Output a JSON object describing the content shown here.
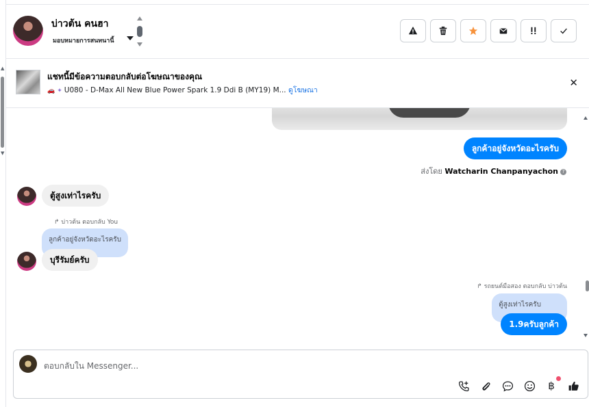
{
  "header": {
    "contact_name": "บ่าวต้น คนฮา",
    "assign_label": "มอบหมายการสนทนานี้",
    "actions": [
      {
        "name": "report-spam-button",
        "icon": "warning-icon"
      },
      {
        "name": "delete-button",
        "icon": "trash-icon"
      },
      {
        "name": "star-button",
        "icon": "star-icon",
        "color": "#f7923b"
      },
      {
        "name": "mark-unread-button",
        "icon": "envelope-icon"
      },
      {
        "name": "follow-up-button",
        "icon": "flag-exclaim-icon"
      },
      {
        "name": "mark-done-button",
        "icon": "check-icon"
      }
    ]
  },
  "ad": {
    "title": "แชทนี้มีข้อความตอบกลับต่อโฆษณาของคุณ",
    "product": "U080 - D-Max All New Blue Power Spark 1.9 Ddi B (MY19) M...",
    "link": "ดูโฆษณา"
  },
  "thread": {
    "msg1": "ลูกค้าอยู่จังหวัดอะไรครับ",
    "sent_by_prefix": "ส่งโดย",
    "sent_by_name": "Watcharin Chanpanyachon",
    "msg2": "ตู้สูงเท่าไรครับ",
    "reply1_meta": "บ่าวต้น ตอบกลับ You",
    "reply1_quote": "ลูกค้าอยู่จังหวัดอะไรครับ",
    "msg3": "บุรีรัมย์ครับ",
    "reply2_meta": "รถยนต์มือสอง ตอบกลับ บ่าวต้น",
    "reply2_quote": "ตู้สูงเท่าไรครับ",
    "msg4": "1.9ครับลูกค้า"
  },
  "composer": {
    "placeholder": "ตอบกลับใน Messenger..."
  },
  "colors": {
    "outgoing": "#0084ff",
    "incoming": "#f0f0f0",
    "quote": "#cfe0fb",
    "link": "#1b74e4"
  }
}
